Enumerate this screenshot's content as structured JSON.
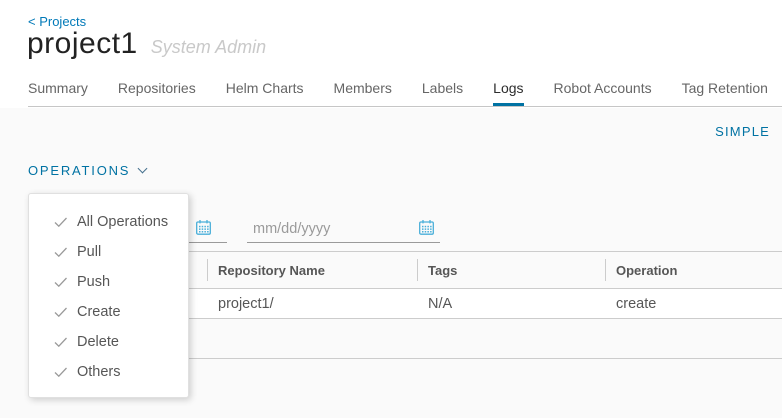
{
  "colors": {
    "link_blue": "#0079b8",
    "accent_blue": "#0072a3",
    "calendar_icon_blue": "#49afd9",
    "text_gray": "#565656",
    "border_gray": "#cccccc",
    "page_bg": "#fafafa"
  },
  "breadcrumb": {
    "back_label": "< Projects"
  },
  "header": {
    "title": "project1",
    "subtitle": "System Admin"
  },
  "tabs": [
    {
      "label": "Summary",
      "active": false
    },
    {
      "label": "Repositories",
      "active": false
    },
    {
      "label": "Helm Charts",
      "active": false
    },
    {
      "label": "Members",
      "active": false
    },
    {
      "label": "Labels",
      "active": false
    },
    {
      "label": "Logs",
      "active": true
    },
    {
      "label": "Robot Accounts",
      "active": false
    },
    {
      "label": "Tag Retention",
      "active": false
    }
  ],
  "toolbar": {
    "mode_toggle_label": "SIMPLE",
    "operations_label": "OPERATIONS"
  },
  "operations_menu": {
    "items": [
      {
        "label": "All Operations",
        "checked": true
      },
      {
        "label": "Pull",
        "checked": true
      },
      {
        "label": "Push",
        "checked": true
      },
      {
        "label": "Create",
        "checked": true
      },
      {
        "label": "Delete",
        "checked": true
      },
      {
        "label": "Others",
        "checked": true
      }
    ]
  },
  "filters": {
    "date_from": {
      "value": "",
      "placeholder": ""
    },
    "date_to": {
      "value": "",
      "placeholder": "mm/dd/yyyy"
    }
  },
  "log_table": {
    "columns": [
      {
        "label": "Repository Name"
      },
      {
        "label": "Tags"
      },
      {
        "label": "Operation"
      }
    ],
    "rows": [
      {
        "repository_name": "project1/",
        "tags": "N/A",
        "operation": "create"
      }
    ]
  },
  "icons": {
    "check_icon": "✓",
    "chevron_down_icon": "∨",
    "calendar_icon": "calendar-grid-glyph"
  }
}
